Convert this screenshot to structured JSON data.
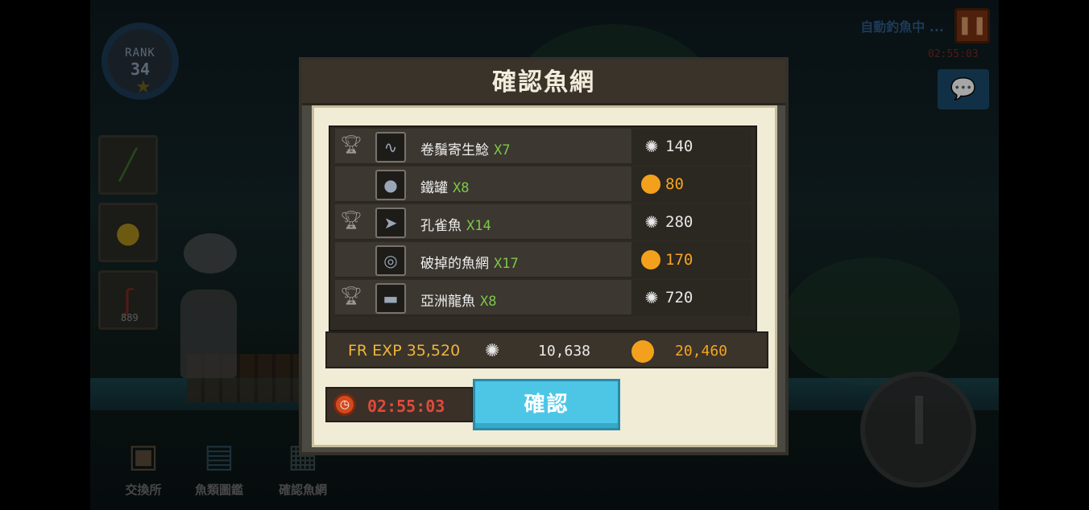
{
  "hud": {
    "rank_label": "RANK",
    "rank_value": "34",
    "auto_fishing": "自動釣魚中 ...",
    "timer": "02:55:03",
    "side_count": "889"
  },
  "bottom_nav": [
    {
      "label": "交換所",
      "icon": "exchange-icon"
    },
    {
      "label": "魚類圖鑑",
      "icon": "fish-book-icon"
    },
    {
      "label": "確認魚網",
      "icon": "fish-net-icon"
    }
  ],
  "dialog": {
    "title": "確認魚網",
    "items": [
      {
        "name": "卷鬚寄生鯰",
        "qty": "X7",
        "trophy": true,
        "reward_type": "exp",
        "reward": "140",
        "thumb": "worm-icon"
      },
      {
        "name": "鐵罐",
        "qty": "X8",
        "trophy": false,
        "reward_type": "coin",
        "reward": "80",
        "thumb": "can-icon"
      },
      {
        "name": "孔雀魚",
        "qty": "X14",
        "trophy": true,
        "reward_type": "exp",
        "reward": "280",
        "thumb": "guppy-icon"
      },
      {
        "name": "破掉的魚網",
        "qty": "X17",
        "trophy": false,
        "reward_type": "coin",
        "reward": "170",
        "thumb": "net-icon"
      },
      {
        "name": "亞洲龍魚",
        "qty": "X8",
        "trophy": true,
        "reward_type": "exp",
        "reward": "720",
        "thumb": "arowana-icon"
      }
    ],
    "summary": {
      "fr_exp": "FR EXP 35,520",
      "exp_total": "10,638",
      "coin_total": "20,460"
    },
    "timer": "02:55:03",
    "confirm_label": "確認"
  },
  "colors": {
    "accent": "#4dc6e6",
    "qty": "#7cc84a",
    "coin": "#f7a51e",
    "timer": "#e04a3a"
  }
}
